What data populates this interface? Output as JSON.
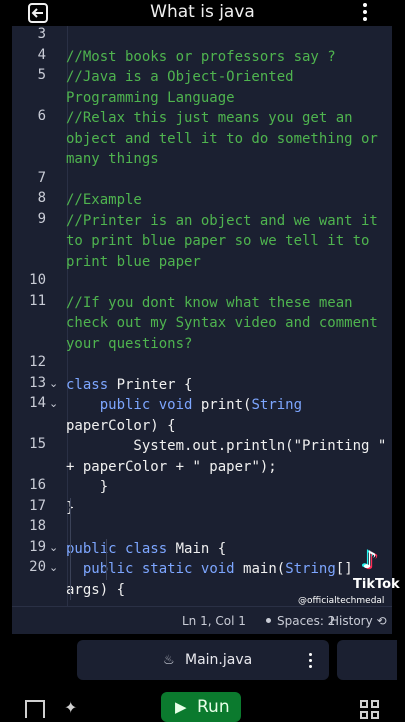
{
  "header": {
    "title": "What is java",
    "back_icon": "exit-icon",
    "menu_icon": "more-vertical-icon"
  },
  "editor": {
    "lines": [
      {
        "num": "3",
        "rows": [
          ""
        ]
      },
      {
        "num": "4",
        "rows": [
          "//Most books or professors say ?"
        ],
        "type": "comment"
      },
      {
        "num": "5",
        "rows": [
          "//Java is a Object-Oriented",
          "Programming Language"
        ],
        "type": "comment"
      },
      {
        "num": "6",
        "rows": [
          "//Relax this just means you get an",
          "object and tell it to do something or",
          "many things"
        ],
        "type": "comment"
      },
      {
        "num": "7",
        "rows": [
          ""
        ]
      },
      {
        "num": "8",
        "rows": [
          "//Example"
        ],
        "type": "comment"
      },
      {
        "num": "9",
        "rows": [
          "//Printer is an object and we want it",
          "to print blue paper so we tell it to",
          "print blue paper"
        ],
        "type": "comment"
      },
      {
        "num": "10",
        "rows": [
          ""
        ]
      },
      {
        "num": "11",
        "rows": [
          "//If you dont know what these mean",
          "check out my Syntax video and comment",
          "your questions?"
        ],
        "type": "comment"
      },
      {
        "num": "12",
        "rows": [
          ""
        ]
      },
      {
        "num": "13",
        "rows": [
          "class Printer {"
        ],
        "fold": true
      },
      {
        "num": "14",
        "rows": [
          "    public void print(String",
          "paperColor) {"
        ],
        "fold": true
      },
      {
        "num": "15",
        "rows": [
          "        System.out.println(\"Printing \"",
          "+ paperColor + \" paper\");"
        ]
      },
      {
        "num": "16",
        "rows": [
          "    }"
        ]
      },
      {
        "num": "17",
        "rows": [
          "}"
        ]
      },
      {
        "num": "18",
        "rows": [
          ""
        ]
      },
      {
        "num": "19",
        "rows": [
          "public class Main {"
        ],
        "fold": true
      },
      {
        "num": "20",
        "rows": [
          "  public static void main(String[]",
          "args) {"
        ],
        "fold": true
      }
    ]
  },
  "status": {
    "position": "Ln 1, Col 1",
    "spaces": "Spaces: 2",
    "history": "History",
    "history_icon": "history-icon"
  },
  "tabs": {
    "file_name": "Main.java",
    "file_icon": "java-file-icon"
  },
  "bottom": {
    "run_label": "Run",
    "play_icon": "play-icon"
  },
  "watermark": {
    "brand": "TikTok",
    "handle": "@officialtechmedal"
  }
}
